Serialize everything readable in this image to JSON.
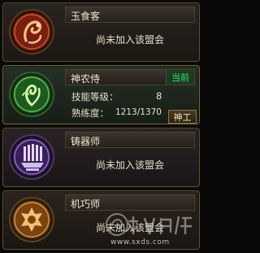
{
  "professions": [
    {
      "name": "玉食客",
      "status": "尚未加入该盟会",
      "icon": "jade-gourmet-emblem-icon",
      "accent": "#c24a2a"
    },
    {
      "name": "神农侍",
      "badge": "当前",
      "skill_label": "技能等级：",
      "skill_level": "8",
      "proficiency_label": "熟练度：",
      "proficiency": "1213/1370",
      "button": "神工",
      "icon": "shennong-emblem-icon",
      "accent": "#4a9a3a"
    },
    {
      "name": "铸器师",
      "status": "尚未加入该盟会",
      "icon": "smith-emblem-icon",
      "accent": "#7a4ab0"
    },
    {
      "name": "机巧师",
      "status": "尚未加入该盟会",
      "icon": "mechanist-emblem-icon",
      "accent": "#e0902a"
    }
  ],
  "watermark": {
    "url": "www.sxds.com",
    "logo": "watermark-logo-icon"
  }
}
